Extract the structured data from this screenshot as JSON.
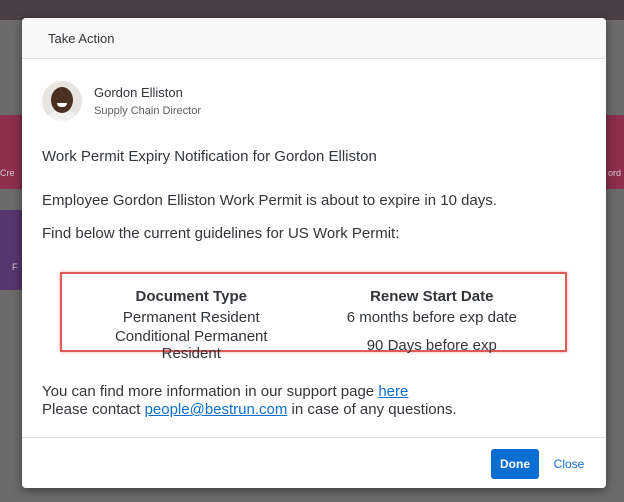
{
  "dialog": {
    "title": "Take Action",
    "person": {
      "name": "Gordon Elliston",
      "title": "Supply Chain Director"
    },
    "subject": "Work Permit Expiry Notification for Gordon Elliston",
    "body_line1": "Employee Gordon Elliston Work Permit is about to expire in 10 days.",
    "body_line2": "Find below the current guidelines for US Work Permit:",
    "table": {
      "headers": [
        "Document Type",
        "Renew Start Date"
      ],
      "rows": [
        [
          "Permanent Resident",
          "6 months before exp date"
        ],
        [
          "Conditional Permanent Resident",
          "90 Days before exp"
        ]
      ]
    },
    "footer": {
      "line1_prefix": "You can find more information in our support page ",
      "line1_link": "here",
      "line2_prefix": "Please contact ",
      "line2_link": "people@bestrun.com",
      "line2_suffix": " in case of any questions."
    },
    "actions": {
      "done_label": "Done",
      "close_label": "Close"
    }
  },
  "background": {
    "left_red_text": "Cre",
    "left_purple_text": "F",
    "right_red_text": "ord"
  },
  "colors": {
    "accent": "#0a6ed1",
    "highlight_border": "#e05a5a"
  }
}
